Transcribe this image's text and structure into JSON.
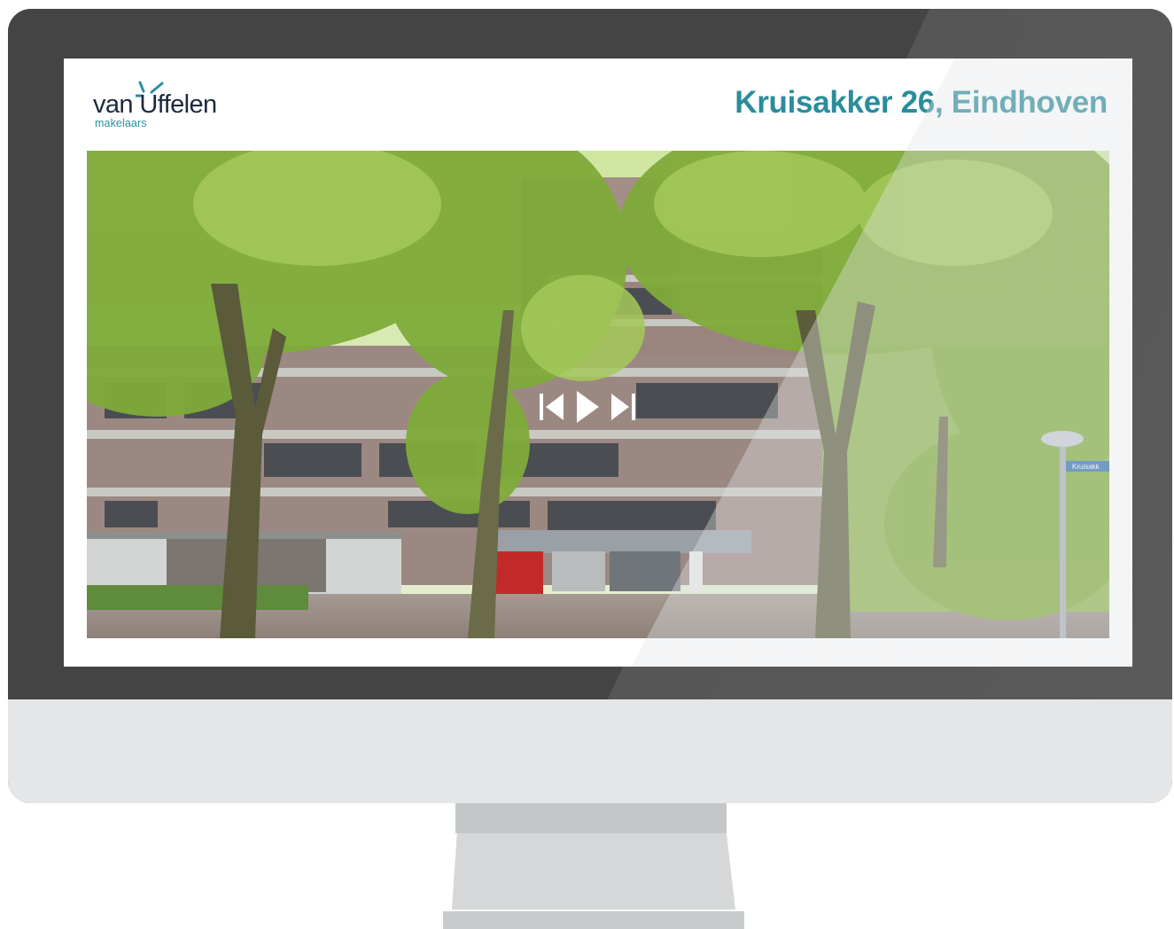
{
  "brand": {
    "name": "van Uffelen",
    "subtitle": "makelaars",
    "primary_color": "#1b2b3c",
    "accent_color": "#2a8d9c"
  },
  "listing": {
    "title": "Kruisakker 26, Eindhoven"
  },
  "slideshow": {
    "controls": [
      "skip-back-icon",
      "play-icon",
      "skip-forward-icon"
    ],
    "street_sign": "Kruisakk"
  }
}
